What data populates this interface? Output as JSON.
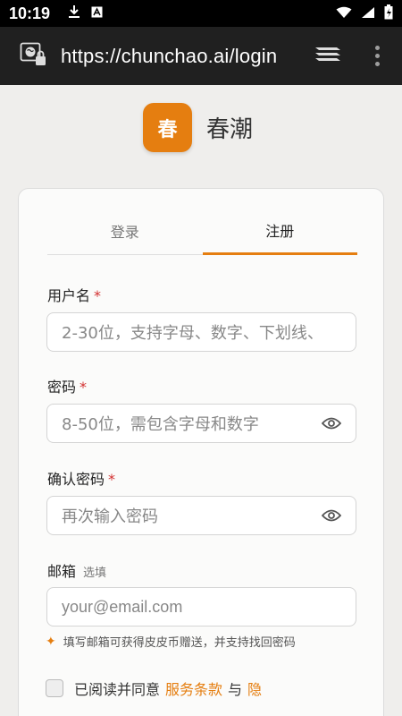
{
  "status_bar": {
    "time": "10:19"
  },
  "url_bar": {
    "url": "https://chunchao.ai/login"
  },
  "brand": {
    "logo_text": "春",
    "name": "春潮"
  },
  "tabs": [
    {
      "label": "登录"
    },
    {
      "label": "注册"
    }
  ],
  "form": {
    "username": {
      "label": "用户名",
      "required": "*",
      "placeholder": "2-30位，支持字母、数字、下划线、"
    },
    "password": {
      "label": "密码",
      "required": "*",
      "placeholder": "8-50位，需包含字母和数字"
    },
    "confirm": {
      "label": "确认密码",
      "required": "*",
      "placeholder": "再次输入密码"
    },
    "email": {
      "label": "邮箱",
      "optional": "选填",
      "placeholder": "your@email.com"
    },
    "hint": "填写邮箱可获得皮皮币赠送，并支持找回密码",
    "agree": {
      "prefix": "已阅读并同意",
      "terms": "服务条款",
      "and": "与",
      "privacy": "隐"
    }
  },
  "colors": {
    "accent": "#e57e10",
    "required": "#d32f2f"
  }
}
